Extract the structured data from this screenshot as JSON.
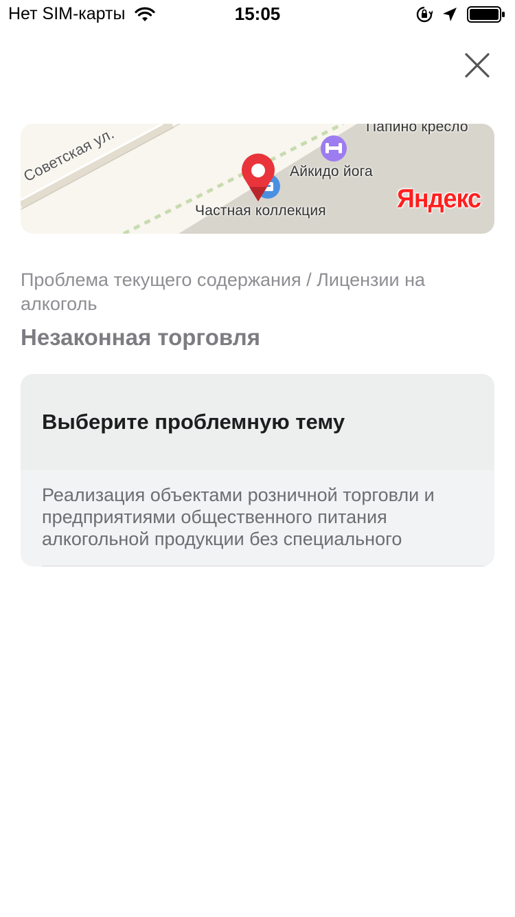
{
  "status_bar": {
    "carrier": "Нет SIM-карты",
    "time": "15:05",
    "icons": [
      "wifi-icon",
      "orientation-lock-icon",
      "location-arrow-icon",
      "battery-icon"
    ]
  },
  "close_icon": "close-icon",
  "map": {
    "street": "Советская ул.",
    "places": [
      {
        "label": "Папино кресло"
      },
      {
        "label": "Айкидо йога",
        "icon": "fitness-icon"
      },
      {
        "label": "Частная коллекция",
        "icon": "shop-icon"
      }
    ],
    "pin_icon": "map-pin-icon",
    "logo": "Яндекс",
    "colors": {
      "pin": "#e8343a",
      "fitness": "#9d7cf0",
      "shop": "#4a90e2"
    }
  },
  "breadcrumb": "Проблема текущего содержания / Лицензии на алкоголь",
  "title": "Незаконная торговля",
  "topic_card": {
    "header": "Выберите проблемную тему",
    "option": "Реализация объектами розничной торговли и предприятиями общественного питания алкогольной продукции без специального"
  }
}
